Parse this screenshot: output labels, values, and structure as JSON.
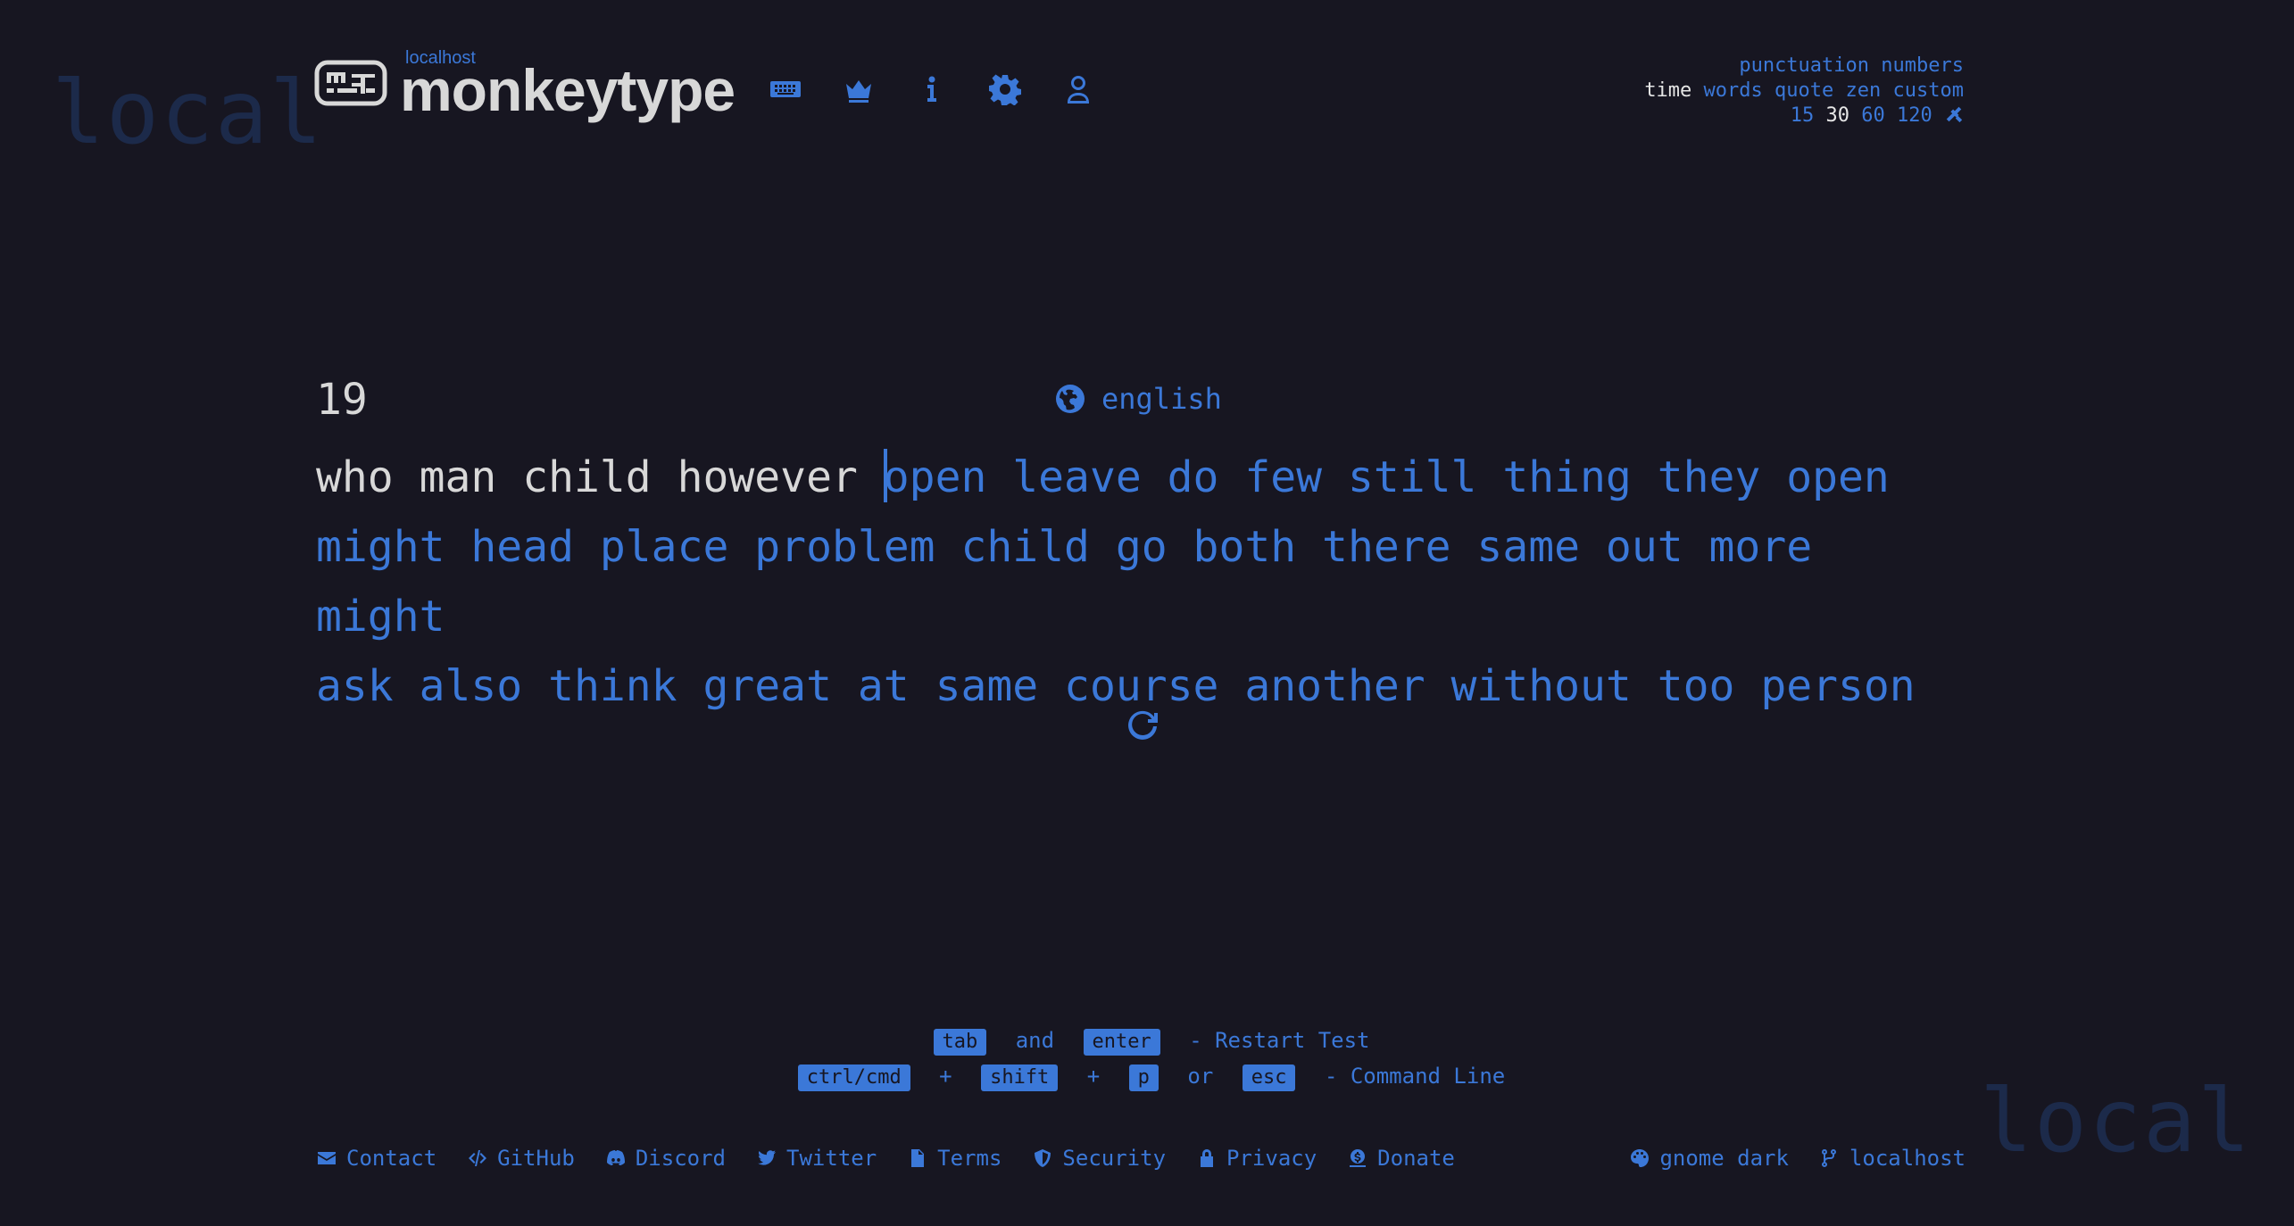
{
  "watermark": "local",
  "logo": {
    "sub": "localhost",
    "title": "monkeytype"
  },
  "nav": [
    {
      "name": "keyboard-icon"
    },
    {
      "name": "crown-icon"
    },
    {
      "name": "info-icon"
    },
    {
      "name": "gear-icon"
    },
    {
      "name": "user-icon"
    }
  ],
  "config": {
    "toggles": [
      "punctuation",
      "numbers"
    ],
    "modes": [
      {
        "label": "time",
        "active": true
      },
      {
        "label": "words",
        "active": false
      },
      {
        "label": "quote",
        "active": false
      },
      {
        "label": "zen",
        "active": false
      },
      {
        "label": "custom",
        "active": false
      }
    ],
    "times": [
      {
        "label": "15",
        "active": false
      },
      {
        "label": "30",
        "active": true
      },
      {
        "label": "60",
        "active": false
      },
      {
        "label": "120",
        "active": false
      }
    ]
  },
  "test": {
    "timer": "19",
    "language": "english",
    "typed": "who man child however ",
    "remaining_line1": "open leave do few still thing they open",
    "line2": "might head place problem child go both there same out more might",
    "line3": "ask also think great at same course another without too person"
  },
  "hints": {
    "row1": {
      "key1": "tab",
      "joiner": "and",
      "key2": "enter",
      "action": "- Restart Test"
    },
    "row2": {
      "key1": "ctrl/cmd",
      "plus1": "+",
      "key2": "shift",
      "plus2": "+",
      "key3": "p",
      "or": "or",
      "key4": "esc",
      "action": "- Command Line"
    }
  },
  "footer": {
    "links": [
      {
        "label": "Contact",
        "icon": "envelope-icon"
      },
      {
        "label": "GitHub",
        "icon": "code-icon"
      },
      {
        "label": "Discord",
        "icon": "discord-icon"
      },
      {
        "label": "Twitter",
        "icon": "twitter-icon"
      },
      {
        "label": "Terms",
        "icon": "document-icon"
      },
      {
        "label": "Security",
        "icon": "shield-icon"
      },
      {
        "label": "Privacy",
        "icon": "lock-icon"
      },
      {
        "label": "Donate",
        "icon": "donate-icon"
      }
    ],
    "theme": "gnome dark",
    "version": "localhost"
  },
  "colors": {
    "bg": "#171621",
    "accent": "#3b78d8",
    "text": "#d8d8d8",
    "watermark": "#1c2a4a"
  }
}
